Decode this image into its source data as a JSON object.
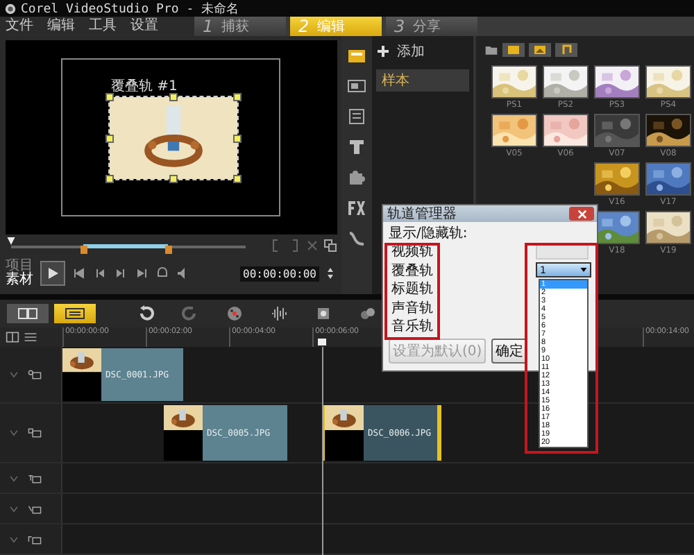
{
  "window": {
    "title": "Corel VideoStudio Pro - 未命名"
  },
  "menu": [
    "文件",
    "编辑",
    "工具",
    "设置"
  ],
  "steps": [
    {
      "number": "1",
      "label": "捕获",
      "selected": false
    },
    {
      "number": "2",
      "label": "编辑",
      "selected": true
    },
    {
      "number": "3",
      "label": "分享",
      "selected": false
    }
  ],
  "preview": {
    "overlay_label": "覆叠轨 #1",
    "kind": "picture"
  },
  "scrubber": {
    "level": 0,
    "trim_in": {
      "level": 0.31
    },
    "trim_out": {
      "level": 0.67
    }
  },
  "play_mode": [
    {
      "label": "项目",
      "selected": false
    },
    {
      "label": "素材",
      "selected": true
    }
  ],
  "timecode": "00:00:00:00",
  "library": {
    "add_label": "添加",
    "folders": [
      {
        "label": "样本",
        "selected": true
      }
    ],
    "rows": [
      [
        {
          "label": "PS1"
        },
        {
          "label": "PS2"
        },
        {
          "label": "PS3"
        },
        {
          "label": "PS4"
        }
      ],
      [
        {
          "label": "V05"
        },
        {
          "label": "V06"
        },
        {
          "label": "V07"
        },
        {
          "label": "V08"
        }
      ],
      [
        {
          "label": "V16"
        },
        {
          "label": "V17"
        }
      ],
      [
        {
          "label": "V18"
        },
        {
          "label": "V19"
        }
      ]
    ]
  },
  "timeline": {
    "view_modes": [
      {
        "kind": "storyboard",
        "selected": false
      },
      {
        "kind": "timeline",
        "selected": true
      }
    ],
    "ticks": [
      {
        "label": "00:00:00:00"
      },
      {
        "label": "00:00:02:00"
      },
      {
        "label": "00:00:04:00"
      },
      {
        "label": "00:00:06:00"
      }
    ],
    "end_tick": {
      "label": "00:00:14:00"
    },
    "tracks": [
      {
        "kind": "video",
        "clips": [
          {
            "label": "DSC_0001.JPG",
            "selected": false
          }
        ]
      },
      {
        "kind": "overlay",
        "clips": [
          {
            "label": "DSC_0005.JPG",
            "selected": false
          },
          {
            "label": "DSC_0006.JPG",
            "selected": true
          }
        ]
      },
      {
        "kind": "title"
      },
      {
        "kind": "voice"
      },
      {
        "kind": "music"
      }
    ]
  },
  "dialog": {
    "title": "轨道管理器",
    "heading": "显示/隐藏轨:",
    "tracks": [
      "视频轨",
      "覆叠轨",
      "标题轨",
      "声音轨",
      "音乐轨"
    ],
    "video_select": {
      "disabled": true
    },
    "overlay_select": {
      "value": "1",
      "expanded": true,
      "options": [
        {
          "label": "1",
          "selected": true
        },
        {
          "label": "2",
          "selected": false
        },
        {
          "label": "3",
          "selected": false
        },
        {
          "label": "4",
          "selected": false
        },
        {
          "label": "5",
          "selected": false
        },
        {
          "label": "6",
          "selected": false
        },
        {
          "label": "7",
          "selected": false
        },
        {
          "label": "8",
          "selected": false
        },
        {
          "label": "9",
          "selected": false
        },
        {
          "label": "10",
          "selected": false
        },
        {
          "label": "11",
          "selected": false
        },
        {
          "label": "12",
          "selected": false
        },
        {
          "label": "13",
          "selected": false
        },
        {
          "label": "14",
          "selected": false
        },
        {
          "label": "15",
          "selected": false
        },
        {
          "label": "16",
          "selected": false
        },
        {
          "label": "17",
          "selected": false
        },
        {
          "label": "18",
          "selected": false
        },
        {
          "label": "19",
          "selected": false
        },
        {
          "label": "20",
          "selected": false
        }
      ]
    },
    "buttons": [
      {
        "label": "设置为默认(0)",
        "disabled": true
      },
      {
        "label": "确定",
        "disabled": false
      }
    ]
  }
}
